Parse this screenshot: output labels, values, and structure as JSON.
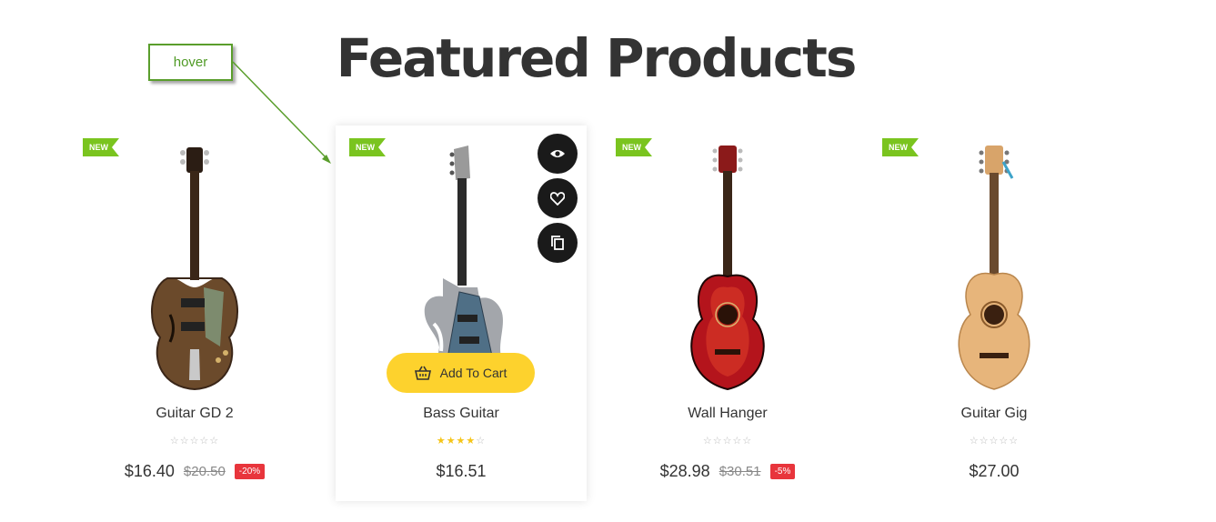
{
  "section": {
    "title": "Featured Products"
  },
  "annotation": {
    "label": "hover"
  },
  "badge_label": "NEW",
  "products": [
    {
      "name": "Guitar GD 2",
      "price": "$16.40",
      "old_price": "$20.50",
      "discount": "-20%",
      "rating": 0,
      "image_icon": "hollow-body-guitar"
    },
    {
      "name": "Bass Guitar",
      "price": "$16.51",
      "rating": 4,
      "image_icon": "electric-guitar",
      "hover_actions": {
        "quick_view_icon": "eye-icon",
        "wishlist_icon": "heart-icon",
        "compare_icon": "copy-icon"
      },
      "add_to_cart_label": "Add To Cart"
    },
    {
      "name": "Wall Hanger",
      "price": "$28.98",
      "old_price": "$30.51",
      "discount": "-5%",
      "rating": 0,
      "image_icon": "red-acoustic-guitar"
    },
    {
      "name": "Guitar Gig",
      "price": "$27.00",
      "rating": 0,
      "image_icon": "classical-guitar"
    }
  ],
  "colors": {
    "badge_new": "#7ac41f",
    "discount": "#e8353c",
    "add_to_cart": "#fdd22d",
    "action_button": "#1a1a1a",
    "star_filled": "#f5c518",
    "annotation_green": "#5a9e2c"
  }
}
